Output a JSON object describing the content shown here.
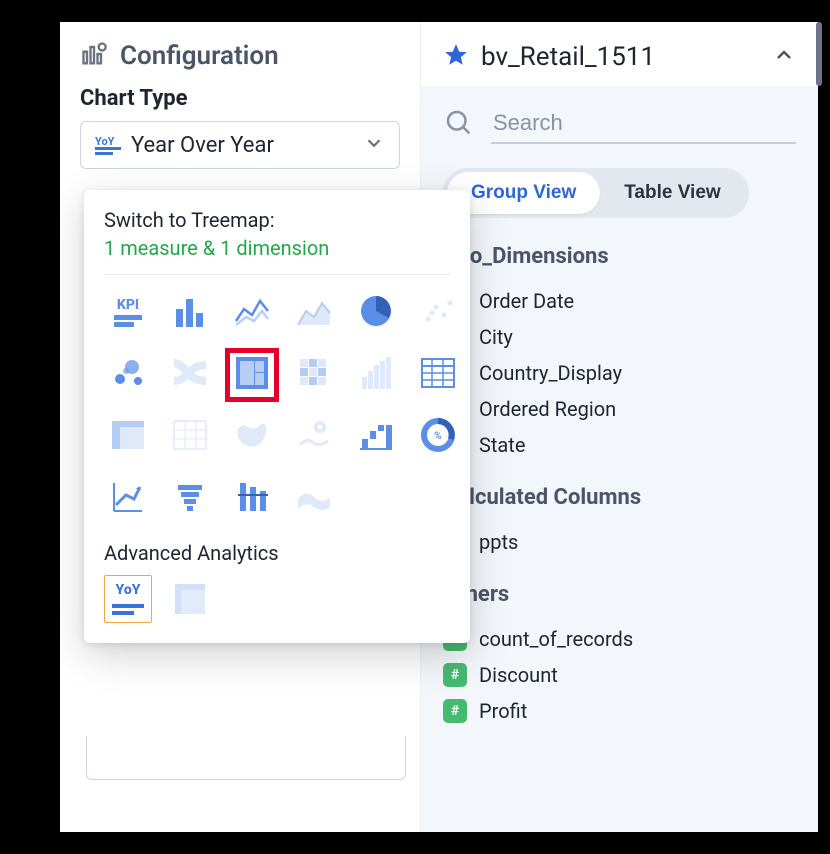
{
  "config": {
    "title": "Configuration",
    "chart_type_label": "Chart Type",
    "selected_chart": "Year Over Year",
    "selected_chart_code": "YoY"
  },
  "popover": {
    "switch_prefix": "Switch to  Treemap:",
    "requirement": "1 measure & 1 dimension",
    "advanced_label": "Advanced Analytics",
    "yoy_code": "YoY",
    "charts": [
      {
        "name": "kpi",
        "dim": false,
        "label": "KPI"
      },
      {
        "name": "bar",
        "dim": false
      },
      {
        "name": "line",
        "dim": false
      },
      {
        "name": "area",
        "dim": true
      },
      {
        "name": "pie",
        "dim": false
      },
      {
        "name": "scatter-light",
        "dim": true
      },
      {
        "name": "bubble",
        "dim": false
      },
      {
        "name": "sankey",
        "dim": true
      },
      {
        "name": "treemap",
        "dim": false,
        "highlight": true
      },
      {
        "name": "heatmap",
        "dim": true
      },
      {
        "name": "stacked-area",
        "dim": true
      },
      {
        "name": "table",
        "dim": false
      },
      {
        "name": "pivot",
        "dim": true
      },
      {
        "name": "crosstab",
        "dim": true
      },
      {
        "name": "geo-map",
        "dim": true
      },
      {
        "name": "geo-pin",
        "dim": true
      },
      {
        "name": "waterfall",
        "dim": false
      },
      {
        "name": "donut",
        "dim": false
      },
      {
        "name": "trend",
        "dim": false
      },
      {
        "name": "funnel",
        "dim": false
      },
      {
        "name": "bullet",
        "dim": false
      },
      {
        "name": "stream",
        "dim": true
      }
    ]
  },
  "dataset": {
    "title": "bv_Retail_1511",
    "search_placeholder": "Search",
    "views": {
      "group": "Group View",
      "table": "Table View"
    },
    "groups": [
      {
        "title": "Geo_Dimensions",
        "fields": [
          {
            "badge": "cal",
            "label": "Order Date"
          },
          {
            "badge": "abc",
            "label": "City"
          },
          {
            "badge": "abc",
            "label": "Country_Display"
          },
          {
            "badge": "abc",
            "label": "Ordered Region"
          },
          {
            "badge": "abc",
            "label": "State"
          }
        ]
      },
      {
        "title": "Calculated Columns",
        "fields": [
          {
            "badge": "hash",
            "label": "ppts"
          }
        ]
      },
      {
        "title": "Others",
        "fields": [
          {
            "badge": "hash",
            "label": "count_of_records"
          },
          {
            "badge": "hash",
            "label": "Discount"
          },
          {
            "badge": "hash",
            "label": "Profit"
          }
        ]
      }
    ]
  }
}
